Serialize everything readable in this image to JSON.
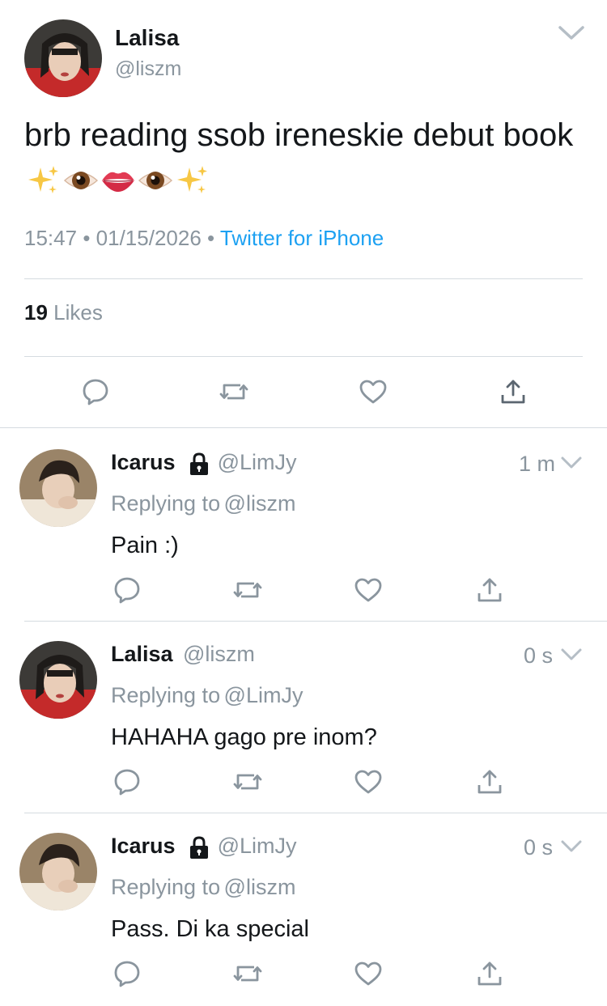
{
  "main_tweet": {
    "author_name": "Lalisa",
    "author_handle": "@liszm",
    "text": "brb reading ssob ireneskie debut book",
    "emojis": [
      "sparkles-emoji",
      "eye-emoji",
      "lips-emoji",
      "eye-emoji",
      "sparkles-emoji"
    ],
    "time": "15:47",
    "date": "01/15/2026",
    "separator": "•",
    "source": "Twitter for iPhone",
    "likes_count": "19",
    "likes_label": "Likes"
  },
  "replies": [
    {
      "author_name": "Icarus",
      "author_handle": "@LimJy",
      "protected": true,
      "time": "1 m",
      "replying_label": "Replying to",
      "replying_handle": "@liszm",
      "text": "Pain :)"
    },
    {
      "author_name": "Lalisa",
      "author_handle": "@liszm",
      "protected": false,
      "time": "0 s",
      "replying_label": "Replying to",
      "replying_handle": "@LimJy",
      "text": "HAHAHA gago pre inom?"
    },
    {
      "author_name": "Icarus",
      "author_handle": "@LimJy",
      "protected": true,
      "time": "0 s",
      "replying_label": "Replying to",
      "replying_handle": "@liszm",
      "text": "Pass. Di ka special"
    }
  ],
  "icons": {
    "reply": "reply-icon",
    "retweet": "retweet-icon",
    "like": "heart-icon",
    "share": "share-icon",
    "menu": "chevron-down-icon",
    "lock": "lock-icon"
  },
  "colors": {
    "text": "#14171a",
    "muted": "#8a959e",
    "link": "#1da1f2",
    "icon": "#8a959e",
    "divider": "#d5dbe0"
  }
}
